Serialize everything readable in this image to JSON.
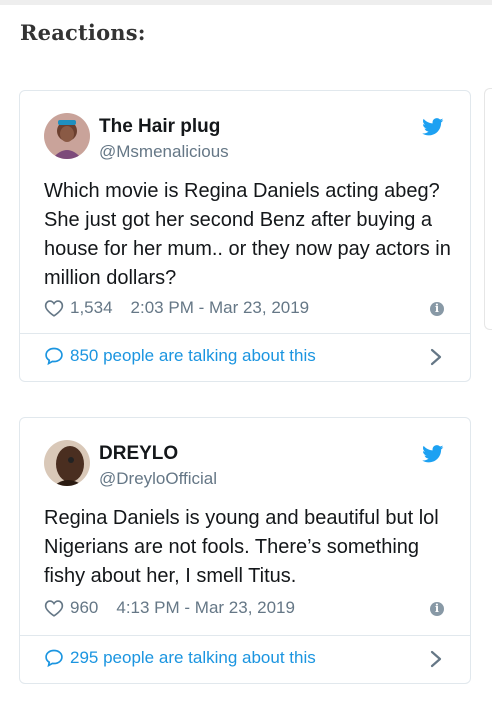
{
  "page": {
    "heading": "Reactions:"
  },
  "tweets": [
    {
      "name": "The Hair plug",
      "handle": "@Msmenalicious",
      "text": "Which movie is Regina Daniels acting abeg? She just got her second Benz after buying a house for her mum.. or they now pay actors in million dollars?",
      "likes": "1,534",
      "timestamp": "2:03 PM - Mar 23, 2019",
      "talking": "850 people are talking about this"
    },
    {
      "name": "DREYLO",
      "handle": "@DreyloOfficial",
      "text": "Regina Daniels is young and beautiful but lol Nigerians are not fools. There’s something fishy about her, I smell Titus.",
      "likes": "960",
      "timestamp": "4:13 PM - Mar 23, 2019",
      "talking": "295 people are talking about this"
    }
  ],
  "colors": {
    "twitter_blue": "#1da1f2",
    "link_blue": "#1b95e0",
    "muted": "#657786",
    "border": "#e1e8ed"
  },
  "icons": [
    "twitter-bird-icon",
    "heart-icon",
    "info-icon",
    "speech-bubble-icon",
    "chevron-right-icon"
  ]
}
